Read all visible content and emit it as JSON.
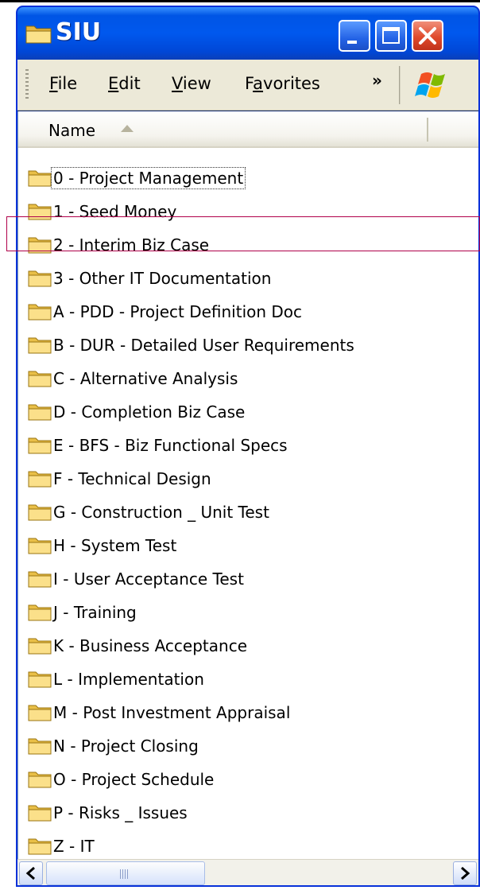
{
  "window": {
    "title": "SIU"
  },
  "menu": {
    "items": [
      {
        "accel": "F",
        "rest": "ile"
      },
      {
        "accel": "E",
        "rest": "dit"
      },
      {
        "accel": "V",
        "rest": "iew"
      },
      {
        "pre": "F",
        "accel": "a",
        "rest": "vorites"
      }
    ],
    "more": "»"
  },
  "list": {
    "column_name": "Name",
    "sort": "ascending",
    "folders": [
      "0 - Project Management",
      "1 - Seed Money",
      "2 - Interim Biz Case",
      "3 - Other IT Documentation",
      "A - PDD - Project Definition Doc",
      "B - DUR - Detailed User Requirements",
      "C - Alternative Analysis",
      "D - Completion Biz Case",
      "E - BFS - Biz Functional Specs",
      "F - Technical Design",
      "G - Construction _ Unit Test",
      "H - System Test",
      "I - User Acceptance Test",
      "J - Training",
      "K - Business Acceptance",
      "L - Implementation",
      "M - Post Investment Appraisal",
      "N - Project Closing",
      "O - Project Schedule",
      "P - Risks _ Issues",
      "Z - IT"
    ],
    "focused_index": 0,
    "highlighted_index": 2
  },
  "colors": {
    "titlebar": "#0058ee",
    "close_button": "#e04a2c",
    "folder": "#f5d76e",
    "highlight_box": "#b0004a"
  },
  "icons": {
    "title": "folder-icon",
    "buttons": [
      "minimize-icon",
      "maximize-icon",
      "close-icon"
    ],
    "sort": "sort-ascending-icon",
    "logo": "windows-logo-icon"
  }
}
